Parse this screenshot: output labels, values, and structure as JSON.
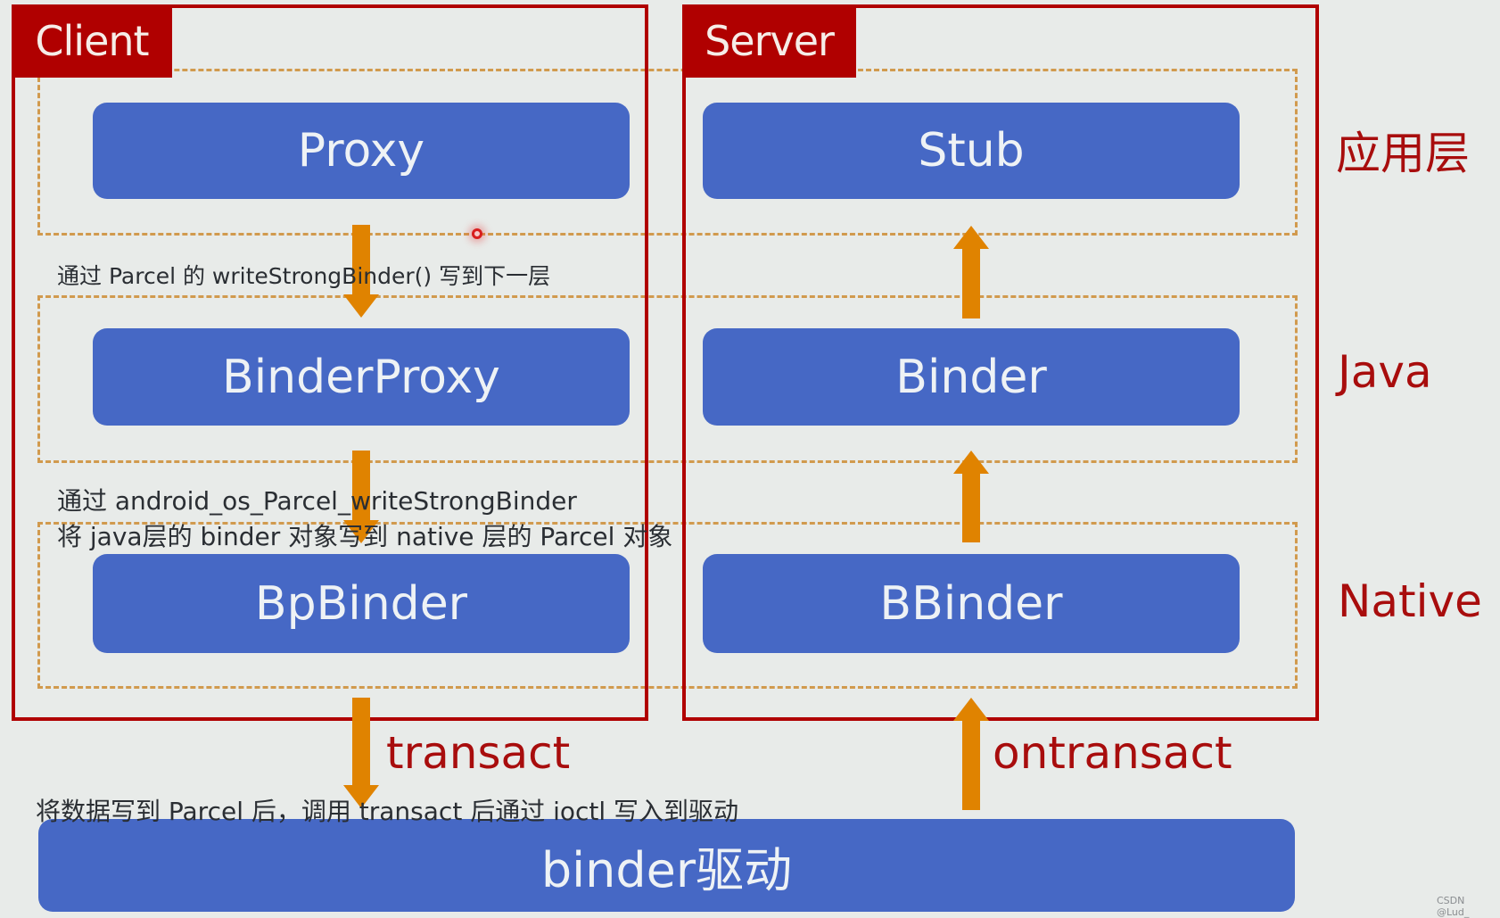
{
  "client": {
    "title": "Client",
    "components": [
      "Proxy",
      "BinderProxy",
      "BpBinder"
    ]
  },
  "server": {
    "title": "Server",
    "components": [
      "Stub",
      "Binder",
      "BBinder"
    ]
  },
  "layers": [
    "应用层",
    "Java",
    "Native"
  ],
  "notes": {
    "proxy_to_binderproxy": "通过 Parcel 的 writeStrongBinder() 写到下一层",
    "binderproxy_to_bpbinder_line1": "通过 android_os_Parcel_writeStrongBinder",
    "binderproxy_to_bpbinder_line2": "将 java层的 binder 对象写到 native 层的 Parcel 对象",
    "bpbinder_to_driver": "将数据写到 Parcel 后，调用 transact 后通过 ioctl 写入到驱动"
  },
  "calls": {
    "client_down": "transact",
    "server_up": "ontransact"
  },
  "driver": {
    "label": "binder驱动"
  },
  "watermark": "CSDN @Lud_",
  "colors": {
    "accent_red": "#B00000",
    "component_blue": "#4668C5",
    "arrow_orange": "#E08300",
    "dashed_band": "#D19A4E",
    "background": "#E8EBE9"
  }
}
